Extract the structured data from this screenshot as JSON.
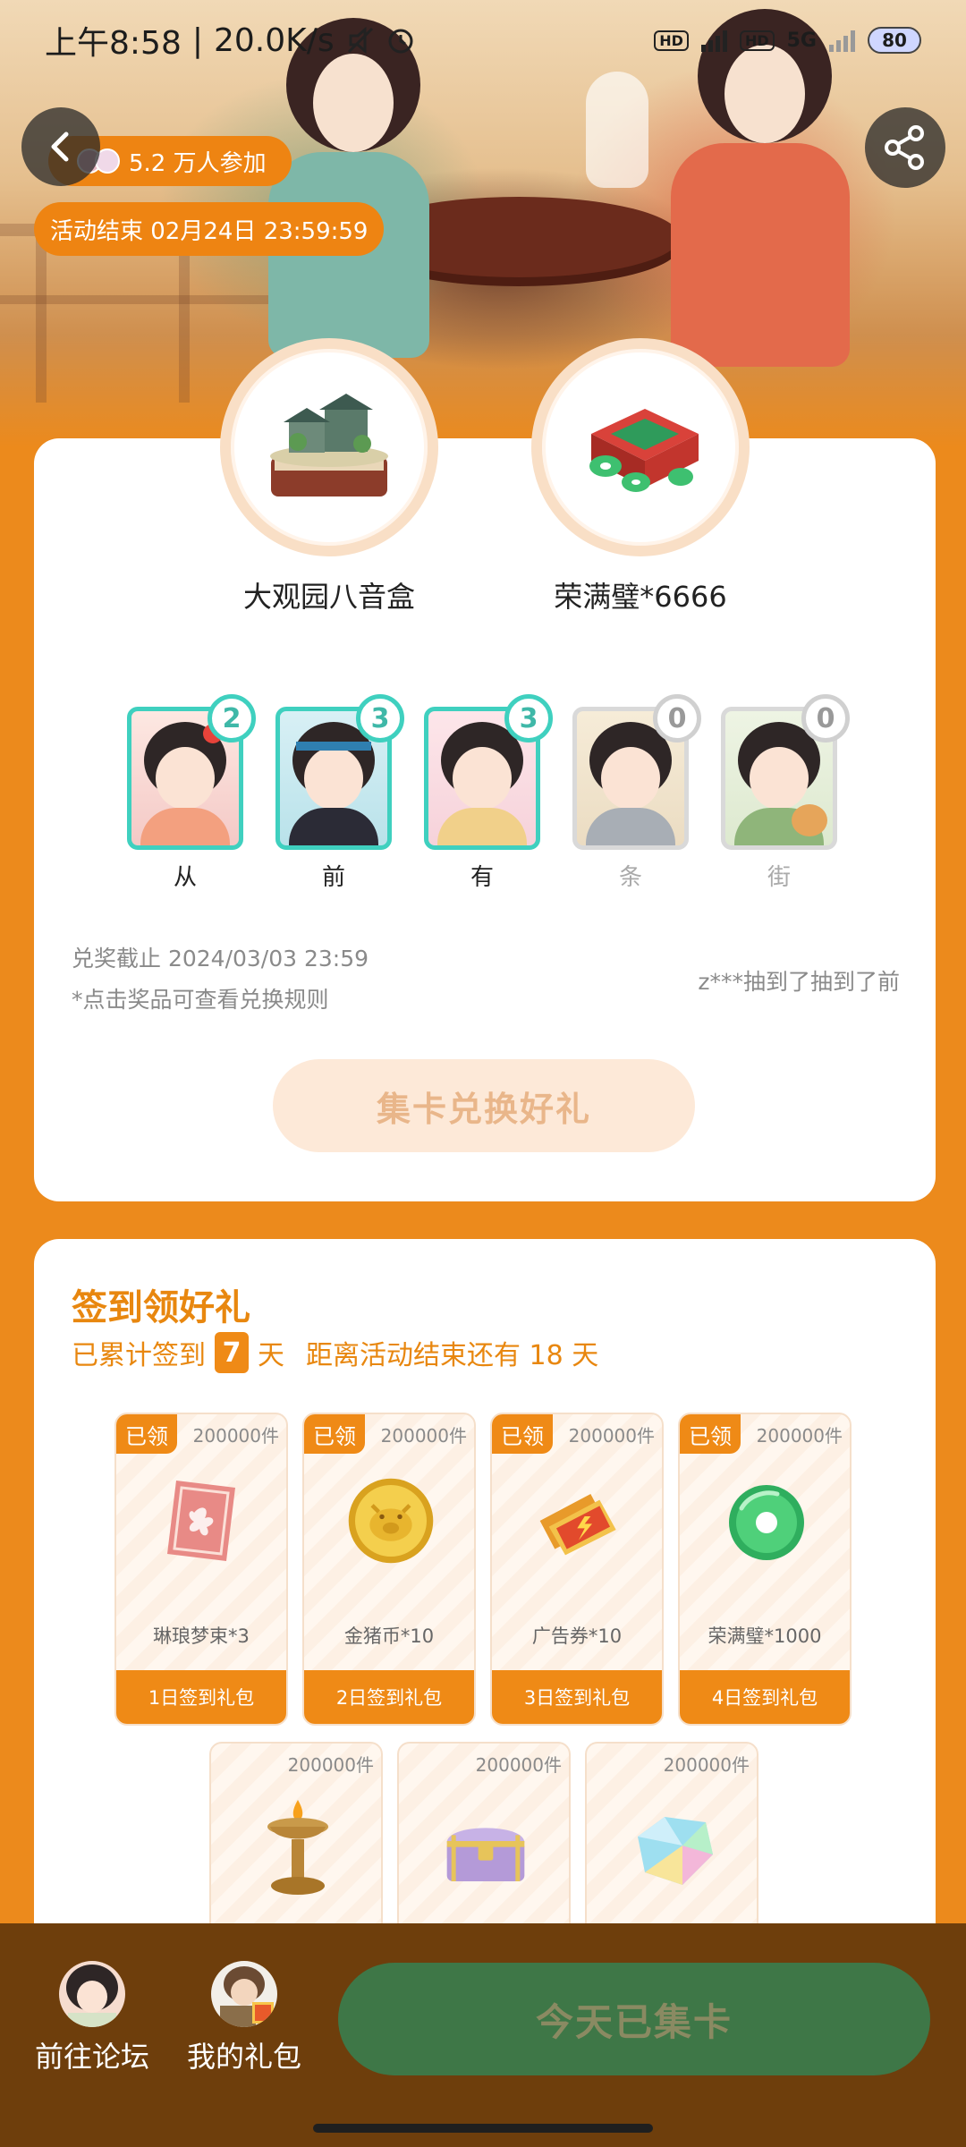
{
  "status_bar": {
    "time": "上午8:58",
    "network_speed": "20.0K/s",
    "hd_label": "HD",
    "network_type": "5G",
    "battery": "80"
  },
  "header": {
    "participants": "5.2 万人参加",
    "activity_end": "活动结束 02月24日 23:59:59"
  },
  "prizes": [
    {
      "name": "大观园八音盒"
    },
    {
      "name": "荣满璧*6666"
    }
  ],
  "characters": [
    {
      "label": "从",
      "count": "2",
      "owned": true
    },
    {
      "label": "前",
      "count": "3",
      "owned": true
    },
    {
      "label": "有",
      "count": "3",
      "owned": true
    },
    {
      "label": "条",
      "count": "0",
      "owned": false
    },
    {
      "label": "街",
      "count": "0",
      "owned": false
    }
  ],
  "redeem": {
    "deadline": "兑奖截止 2024/03/03 23:59",
    "rule_hint": "*点击奖品可查看兑换规则",
    "draw_message": "z***抽到了抽到了前",
    "exchange_button": "集卡兑换好礼"
  },
  "signin": {
    "title": "签到领好礼",
    "cumulative_prefix": "已累计签到",
    "days": "7",
    "day_unit": "天",
    "remaining_text": "距离活动结束还有 18 天",
    "claimed_label": "已领",
    "gifts": [
      {
        "count": "200000件",
        "name": "琳琅梦束*3",
        "pack": "1日签到礼包",
        "claimed": true
      },
      {
        "count": "200000件",
        "name": "金猪币*10",
        "pack": "2日签到礼包",
        "claimed": true
      },
      {
        "count": "200000件",
        "name": "广告券*10",
        "pack": "3日签到礼包",
        "claimed": true
      },
      {
        "count": "200000件",
        "name": "荣满璧*1000",
        "pack": "4日签到礼包",
        "claimed": true
      },
      {
        "count": "200000件",
        "claimed": false
      },
      {
        "count": "200000件",
        "claimed": false
      },
      {
        "count": "200000件",
        "claimed": false
      }
    ]
  },
  "bottom_bar": {
    "forum_label": "前往论坛",
    "gifts_label": "我的礼包",
    "collect_button": "今天已集卡"
  },
  "colors": {
    "brand_orange": "#ec8a1c",
    "teal_owned": "#3fd0bf",
    "bottom_bar": "#6e3e0c",
    "collect_button": "#3e7747"
  }
}
